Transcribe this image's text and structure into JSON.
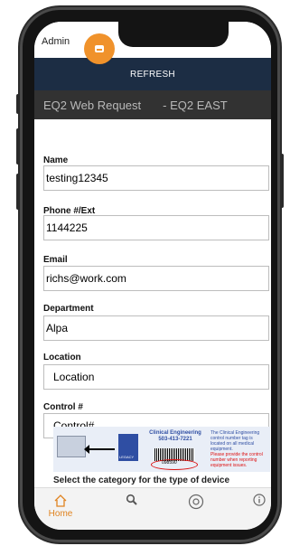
{
  "status": {
    "user": "Admin"
  },
  "toolbar": {
    "refresh_label": "REFRESH"
  },
  "title_bar": {
    "title": "EQ2 Web Request",
    "site": "- EQ2 EAST"
  },
  "form": {
    "name": {
      "label": "Name",
      "value": "testing12345"
    },
    "phone": {
      "label": "Phone #/Ext",
      "value": "1144225"
    },
    "email": {
      "label": "Email",
      "value": "richs@work.com"
    },
    "department": {
      "label": "Department",
      "value": "Alpa"
    },
    "location": {
      "label": "Location",
      "value": "Location"
    },
    "control": {
      "label": "Control #",
      "value": "Control#"
    }
  },
  "banner": {
    "header": "Clinical Engineering",
    "phone": "503-413-7221",
    "barcode_number": "098590",
    "note_top": "The Clinical Engineering control number tag is located on all medical equipment.",
    "note_bottom": "Please provide the control number when reporting equipment issues.",
    "brand": "LEGACY"
  },
  "category_prompt": "Select the category for the type of device",
  "tabs": [
    {
      "label": "Home",
      "icon": "home-icon",
      "active": true
    },
    {
      "label": "",
      "icon": "search-icon"
    },
    {
      "label": "",
      "icon": "support-icon"
    },
    {
      "label": "",
      "icon": "info-icon"
    }
  ],
  "colors": {
    "accent": "#f0922b",
    "navbar": "#1c2d44",
    "titlebar": "#323232"
  }
}
